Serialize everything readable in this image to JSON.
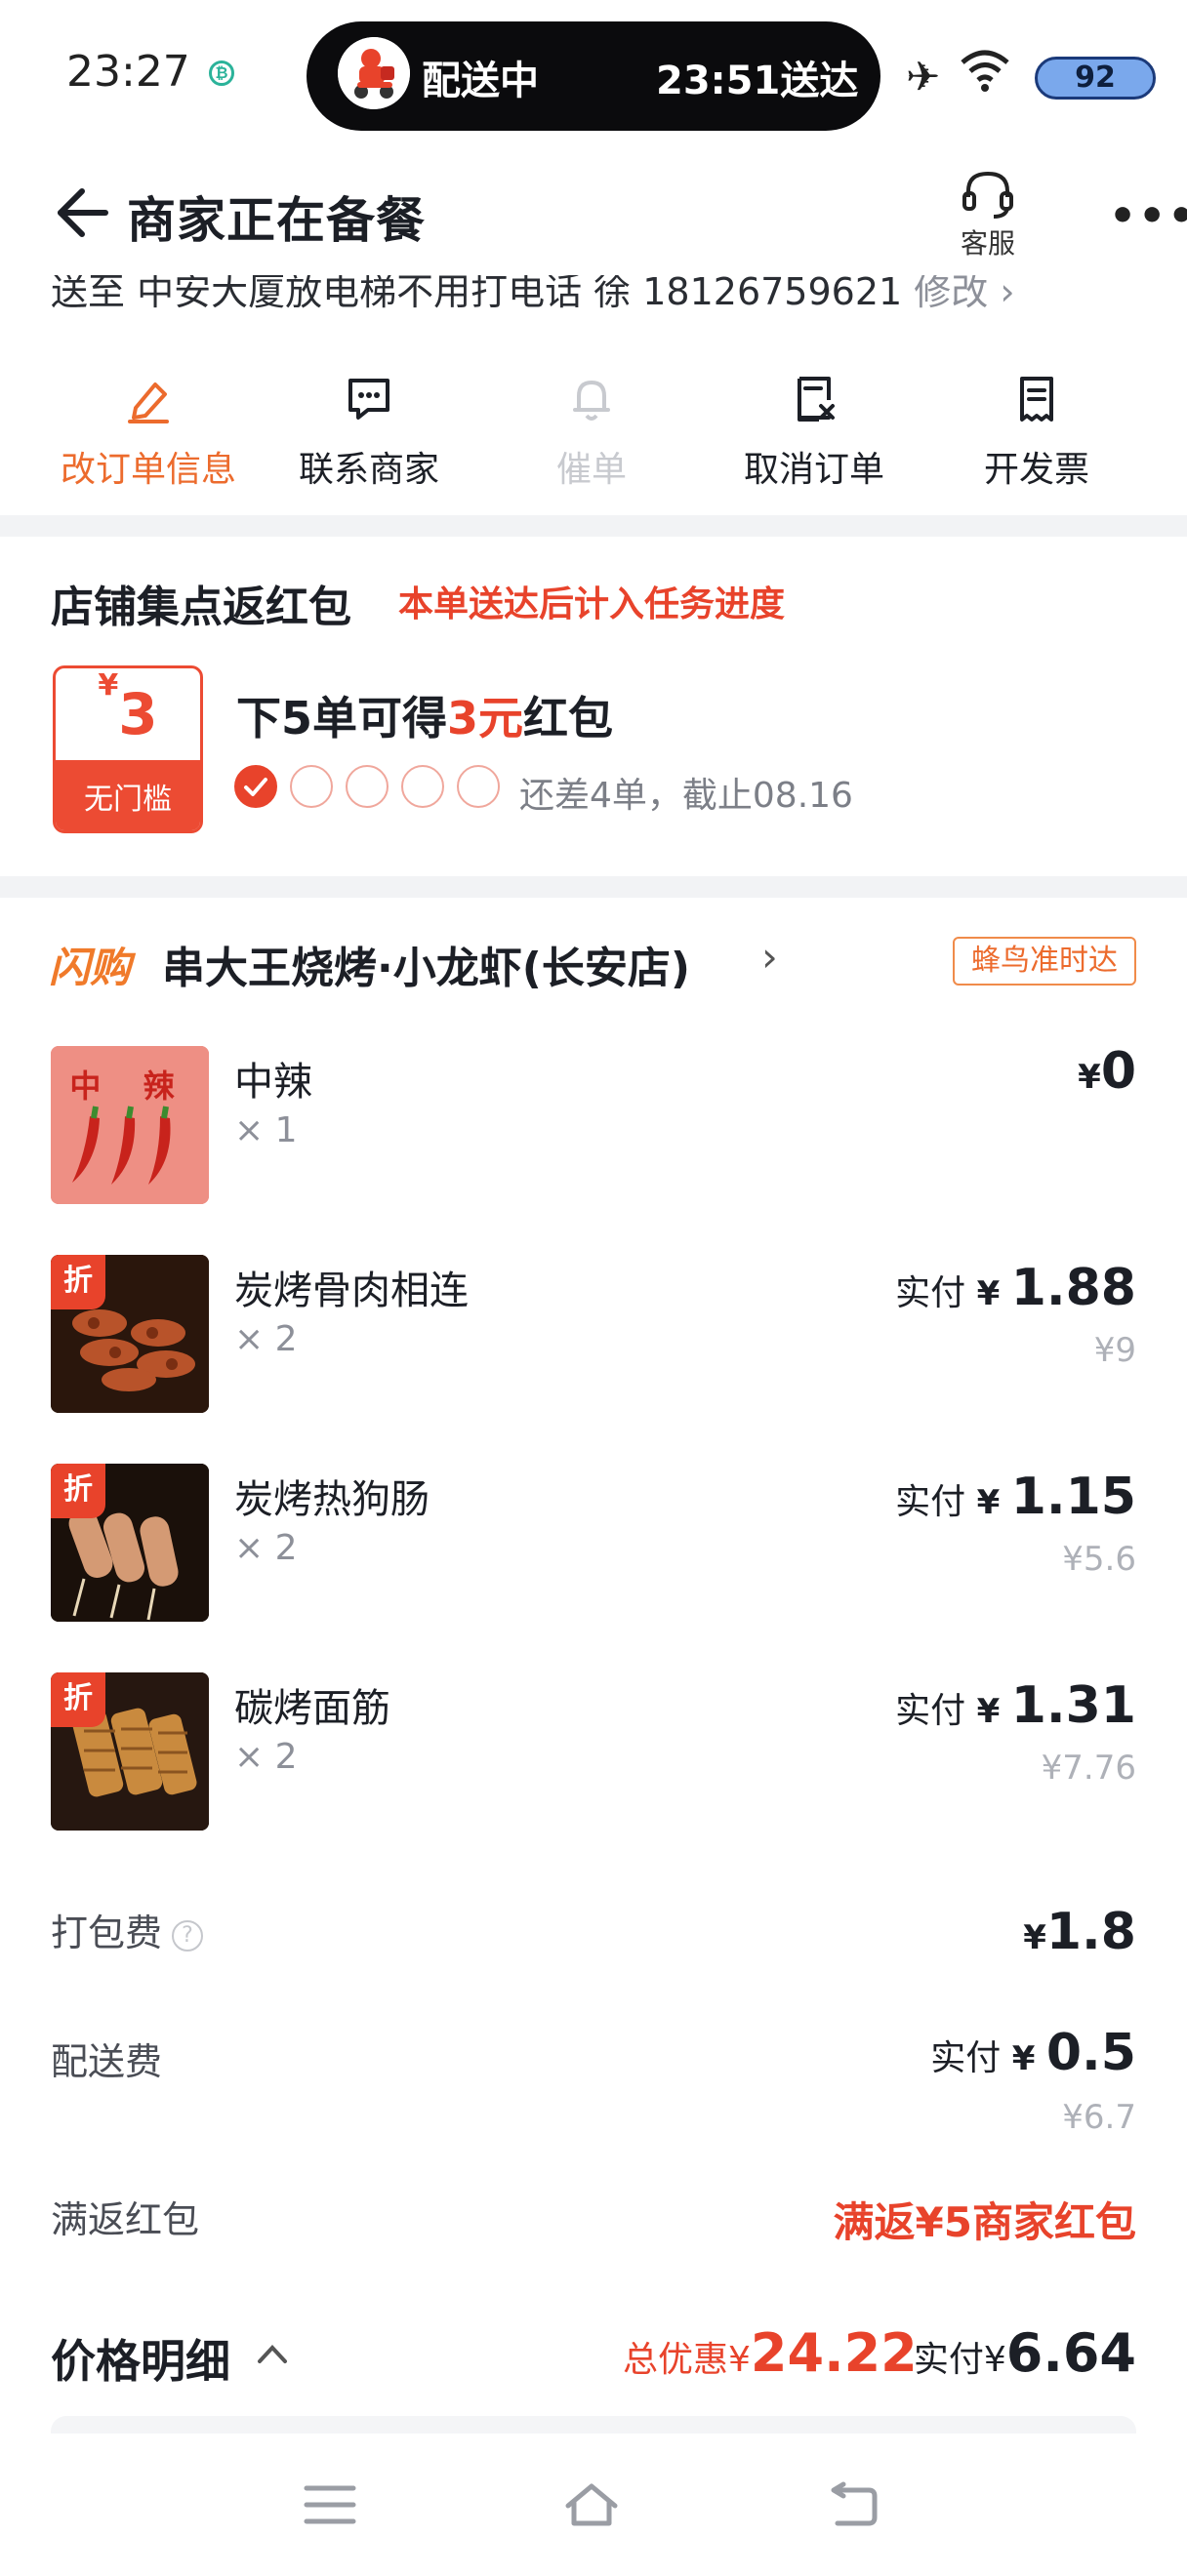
{
  "status": {
    "time": "23:27",
    "pill_status": "配送中",
    "pill_eta": "23:51送达",
    "battery": "92"
  },
  "header": {
    "title": "商家正在备餐",
    "service_label": "客服",
    "more": "•••"
  },
  "address": {
    "text": "送至 中安大厦放电梯不用打电话 徐 18126759621",
    "edit": "修改 ›"
  },
  "actions": [
    {
      "label": "改订单信息"
    },
    {
      "label": "联系商家"
    },
    {
      "label": "催单"
    },
    {
      "label": "取消订单"
    },
    {
      "label": "开发票"
    }
  ],
  "promo": {
    "title": "店铺集点返红包",
    "subtitle": "本单送达后计入任务进度",
    "coupon_symbol": "¥",
    "coupon_amount": "3",
    "coupon_label": "无门槛",
    "line_pre": "下5单可得",
    "line_amount": "3元",
    "line_post": "红包",
    "progress_done": 1,
    "progress_total": 5,
    "progress_text": "还差4单，截止08.16"
  },
  "store": {
    "badge": "闪购",
    "name": "串大王烧烤·小龙虾(长安店)",
    "arrow": "›",
    "tag": "蜂鸟准时达"
  },
  "items": [
    {
      "name": "中辣",
      "qty": "× 1",
      "pay_prefix": "",
      "yen": "¥",
      "price": "0",
      "original": "",
      "thumb_text": "中 辣",
      "discount_badge": ""
    },
    {
      "name": "炭烤骨肉相连",
      "qty": "× 2",
      "pay_prefix": "实付",
      "yen": "¥",
      "price": "1.88",
      "original": "¥9",
      "discount_badge": "折"
    },
    {
      "name": "炭烤热狗肠",
      "qty": "× 2",
      "pay_prefix": "实付",
      "yen": "¥",
      "price": "1.15",
      "original": "¥5.6",
      "discount_badge": "折"
    },
    {
      "name": "碳烤面筋",
      "qty": "× 2",
      "pay_prefix": "实付",
      "yen": "¥",
      "price": "1.31",
      "original": "¥7.76",
      "discount_badge": "折"
    }
  ],
  "fees": {
    "packing_label": "打包费",
    "packing_help": "?",
    "packing_yen": "¥",
    "packing_price": "1.8",
    "delivery_label": "配送费",
    "delivery_prefix": "实付",
    "delivery_yen": "¥",
    "delivery_price": "0.5",
    "delivery_original": "¥6.7",
    "rebate_label": "满返红包",
    "rebate_value": "满返¥5商家红包"
  },
  "summary": {
    "title": "价格明细",
    "chevron": "^",
    "discount_prefix": "总优惠",
    "discount_yen": "¥",
    "discount_value": "24.22",
    "pay_prefix": "实付",
    "pay_yen": "¥",
    "pay_value": "6.64"
  },
  "colors": {
    "accent": "#ec6b2d",
    "red": "#e8432b",
    "text": "#1c1f26",
    "muted": "#8d9099"
  }
}
